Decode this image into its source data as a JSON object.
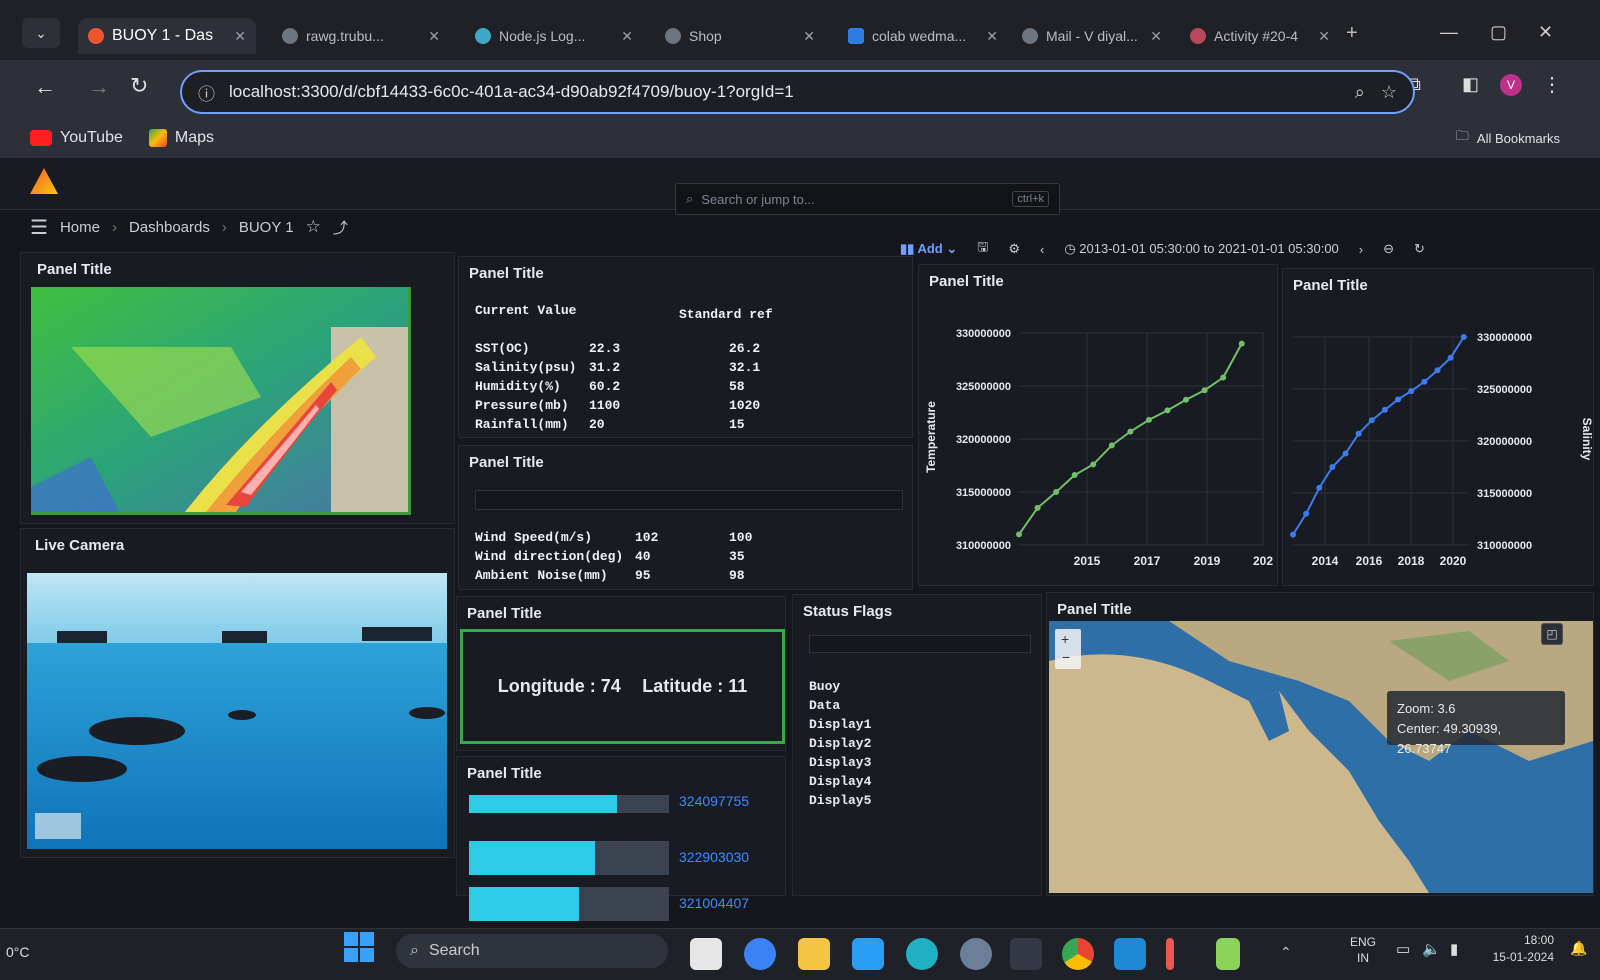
{
  "browser": {
    "tabs": [
      {
        "label": "BUOY 1 - Das",
        "active": true
      },
      {
        "label": "rawg.trubu..."
      },
      {
        "label": "Node.js Log..."
      },
      {
        "label": "Shop"
      },
      {
        "label": "colab wedma..."
      },
      {
        "label": "Mail - V diyal..."
      },
      {
        "label": "Activity #20-4"
      }
    ],
    "url": "localhost:3300/d/cbf14433-6c0c-401a-ac34-d90ab92f4709/buoy-1?orgId=1",
    "bookmarks": [
      "YouTube",
      "Maps"
    ],
    "all_bookmarks": "All Bookmarks"
  },
  "grafana": {
    "search_placeholder": "Search or jump to...",
    "search_shortcut": "ctrl+k",
    "breadcrumbs": [
      "Home",
      "Dashboards",
      "BUOY 1"
    ],
    "add_label": "Add",
    "time_range": "2013-01-01 05:30:00 to 2021-01-01 05:30:00"
  },
  "panels": {
    "map_heat_title": "Panel Title",
    "live_camera_title": "Live Camera",
    "values_title": "Panel Title",
    "values_headers": {
      "current": "Current Value",
      "standard": "Standard ref"
    },
    "values_rows": [
      {
        "label": "SST(OC)",
        "current": "22.3",
        "ref": "26.2"
      },
      {
        "label": "Salinity(psu)",
        "current": "31.2",
        "ref": "32.1"
      },
      {
        "label": "Humidity(%)",
        "current": "60.2",
        "ref": "58"
      },
      {
        "label": "Pressure(mb)",
        "current": "1100",
        "ref": "1020"
      },
      {
        "label": "Rainfall(mm)",
        "current": "20",
        "ref": "15"
      }
    ],
    "wind_title": "Panel Title",
    "wind_rows": [
      {
        "label": "Wind Speed(m/s)",
        "current": "102",
        "ref": "100"
      },
      {
        "label": "Wind direction(deg)",
        "current": "40",
        "ref": "35"
      },
      {
        "label": "Ambient Noise(mm)",
        "current": "95",
        "ref": "98"
      }
    ],
    "coords_title": "Panel Title",
    "longitude": "Longitude : 74",
    "latitude": "Latitude : 11",
    "bars_title": "Panel Title",
    "status_title": "Status Flags",
    "status_items": [
      "Buoy",
      "Data",
      "Display1",
      "Display2",
      "Display3",
      "Display4",
      "Display5"
    ],
    "worldmap_title": "Panel Title",
    "zoom_label": "Zoom:  3.6",
    "center_label": "Center: 49.30939, 26.73747",
    "temp_chart_title": "Panel Title",
    "sal_chart_title": "Panel Title"
  },
  "chart_data": [
    {
      "type": "line",
      "title": "Panel Title",
      "ylabel": "Temperature",
      "x": [
        2014,
        2014.5,
        2015,
        2015.5,
        2016,
        2016.5,
        2017,
        2017.5,
        2018,
        2018.5,
        2019,
        2019.5,
        2020
      ],
      "values": [
        311000000,
        313500000,
        315000000,
        316600000,
        317600000,
        319400000,
        320700000,
        321800000,
        322700000,
        323700000,
        324600000,
        325800000,
        329000000
      ],
      "xticks": [
        "2015",
        "2017",
        "2019",
        "202"
      ],
      "yticks": [
        "310000000",
        "315000000",
        "320000000",
        "325000000",
        "330000000"
      ],
      "ylim": [
        310000000,
        330000000
      ],
      "color": "#73bf69"
    },
    {
      "type": "line",
      "title": "Panel Title",
      "ylabel": "Salinity",
      "x": [
        2013.5,
        2014,
        2014.5,
        2015,
        2015.5,
        2016,
        2016.5,
        2017,
        2017.5,
        2018,
        2018.5,
        2019,
        2019.5,
        2020
      ],
      "values": [
        311000000,
        313000000,
        315500000,
        317500000,
        318800000,
        320700000,
        322000000,
        323000000,
        324000000,
        324800000,
        325700000,
        326800000,
        328000000,
        330000000
      ],
      "xticks": [
        "2014",
        "2016",
        "2018",
        "2020"
      ],
      "yticks": [
        "310000000",
        "315000000",
        "320000000",
        "325000000",
        "330000000"
      ],
      "ylim": [
        310000000,
        330000000
      ],
      "color": "#3d7cf0"
    },
    {
      "type": "bar",
      "orientation": "horizontal",
      "title": "Panel Title",
      "labels": [
        "324097755",
        "322903030",
        "321004407"
      ],
      "values": [
        0.74,
        0.63,
        0.55
      ],
      "color": "#2ecbe8"
    }
  ],
  "taskbar": {
    "weather": "0°C",
    "search": "Search",
    "lang": "ENG",
    "region": "IN",
    "time": "18:00",
    "date": "15-01-2024"
  }
}
